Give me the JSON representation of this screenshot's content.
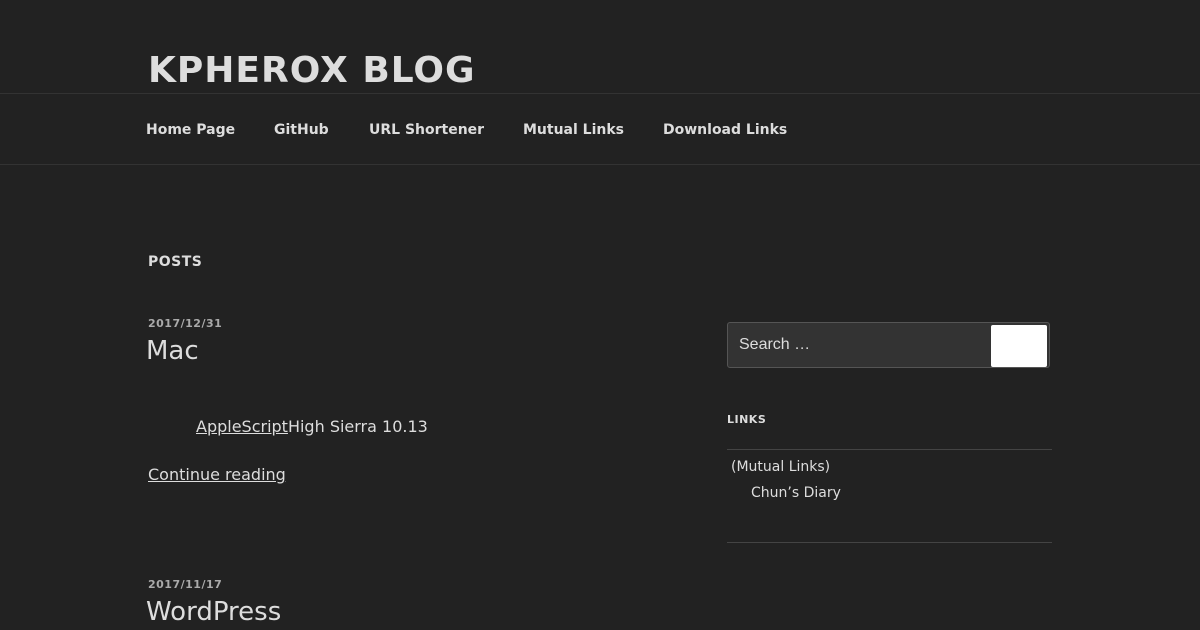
{
  "site": {
    "title": "KPHEROX BLOG"
  },
  "nav": {
    "items": [
      {
        "label": "Home Page"
      },
      {
        "label": "GitHub"
      },
      {
        "label": "URL Shortener"
      },
      {
        "label": "Mutual Links"
      },
      {
        "label": "Download Links"
      }
    ]
  },
  "main": {
    "section_heading": "POSTS",
    "posts": [
      {
        "date": "2017/12/31",
        "title": "Mac",
        "excerpt_link": "AppleScript",
        "excerpt_text": "High Sierra 10.13",
        "continue_label": "Continue reading"
      },
      {
        "date": "2017/11/17",
        "title": "WordPress"
      }
    ]
  },
  "sidebar": {
    "search": {
      "placeholder": "Search …"
    },
    "links_widget": {
      "title": "LINKS",
      "category": "(Mutual Links)",
      "items": [
        {
          "label": "Chun’s Diary"
        }
      ]
    }
  },
  "colors": {
    "background": "#222222",
    "text": "#dddddd",
    "muted_text": "#aaaaaa",
    "divider": "#444444"
  }
}
